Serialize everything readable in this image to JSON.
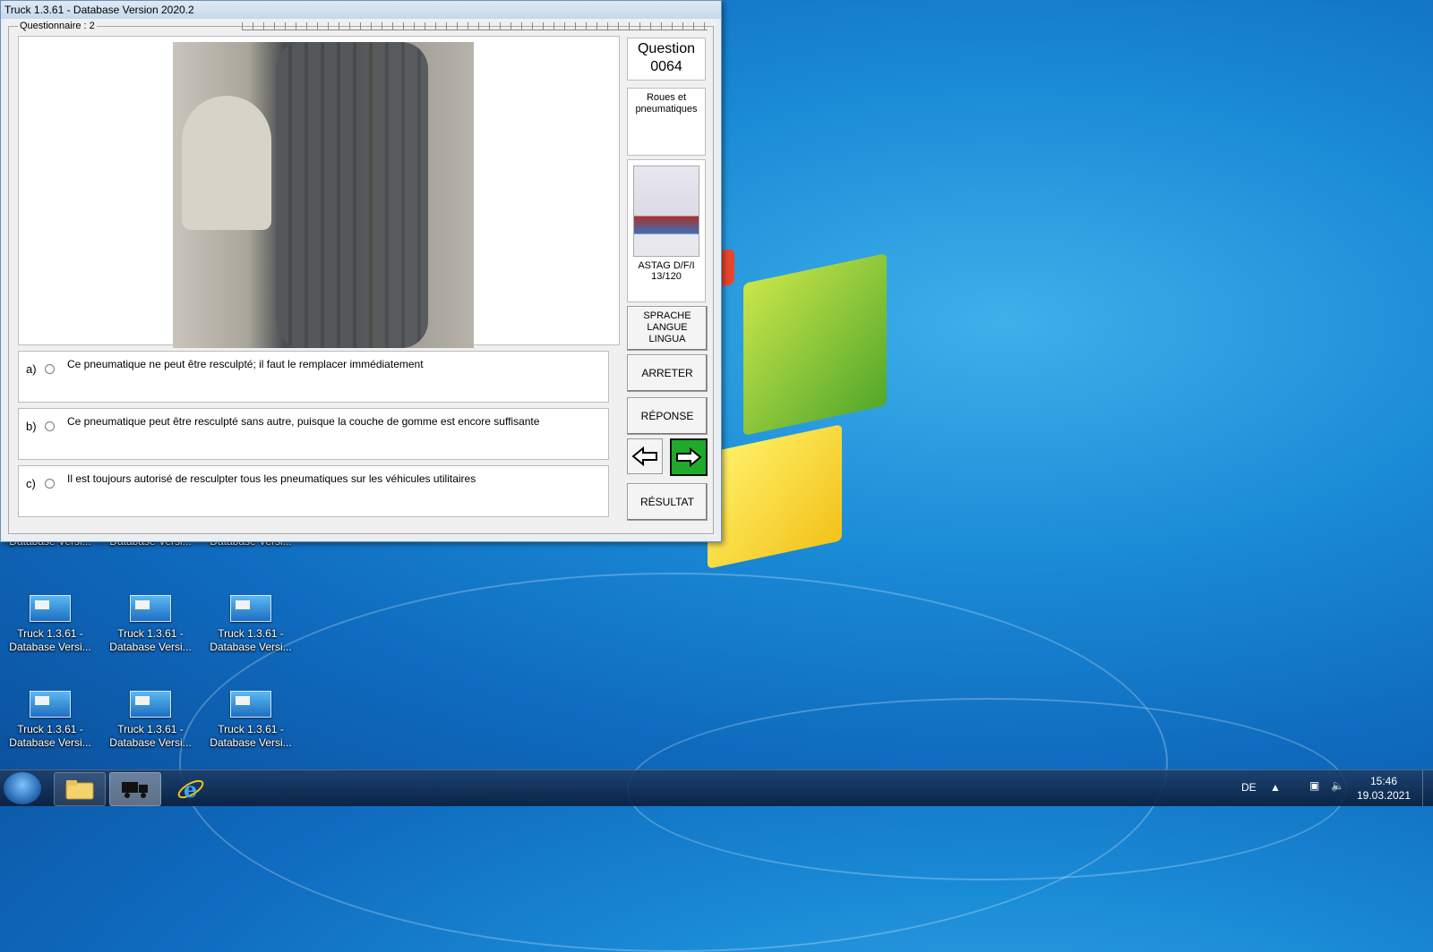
{
  "window": {
    "title": "Truck 1.3.61 - Database Version 2020.2",
    "group_label": "Questionnaire : 2"
  },
  "question": {
    "label": "Question",
    "number": "0064",
    "category": "Roues et pneumatiques",
    "book_ref_line1": "ASTAG D/F/I",
    "book_ref_line2": "13/120"
  },
  "answers": [
    {
      "letter": "a)",
      "text": "Ce pneumatique ne peut être resculpté; il faut le remplacer immédiatement"
    },
    {
      "letter": "b)",
      "text": "Ce pneumatique peut être resculpté sans autre, puisque la couche de gomme est encore suffisante"
    },
    {
      "letter": "c)",
      "text": "Il est toujours autorisé de resculpter tous les pneumatiques sur les véhicules utilitaires"
    }
  ],
  "buttons": {
    "language_line1": "SPRACHE",
    "language_line2": "LANGUE",
    "language_line3": "LINGUA",
    "stop": "ARRETER",
    "answer": "RÉPONSE",
    "result": "RÉSULTAT"
  },
  "desktop_icons": [
    {
      "line1": "",
      "line2": "Database Versi..."
    },
    {
      "line1": "",
      "line2": "Database Versi..."
    },
    {
      "line1": "",
      "line2": "Database Versi..."
    },
    {
      "line1": "Truck 1.3.61 -",
      "line2": "Database Versi..."
    },
    {
      "line1": "Truck 1.3.61 -",
      "line2": "Database Versi..."
    },
    {
      "line1": "Truck 1.3.61 -",
      "line2": "Database Versi..."
    },
    {
      "line1": "Truck 1.3.61 -",
      "line2": "Database Versi..."
    },
    {
      "line1": "Truck 1.3.61 -",
      "line2": "Database Versi..."
    },
    {
      "line1": "Truck 1.3.61 -",
      "line2": "Database Versi..."
    }
  ],
  "taskbar": {
    "language": "DE",
    "time": "15:46",
    "date": "19.03.2021"
  },
  "colors": {
    "next_button": "#1faa2a",
    "desktop_blue": "#1a8bd6"
  }
}
